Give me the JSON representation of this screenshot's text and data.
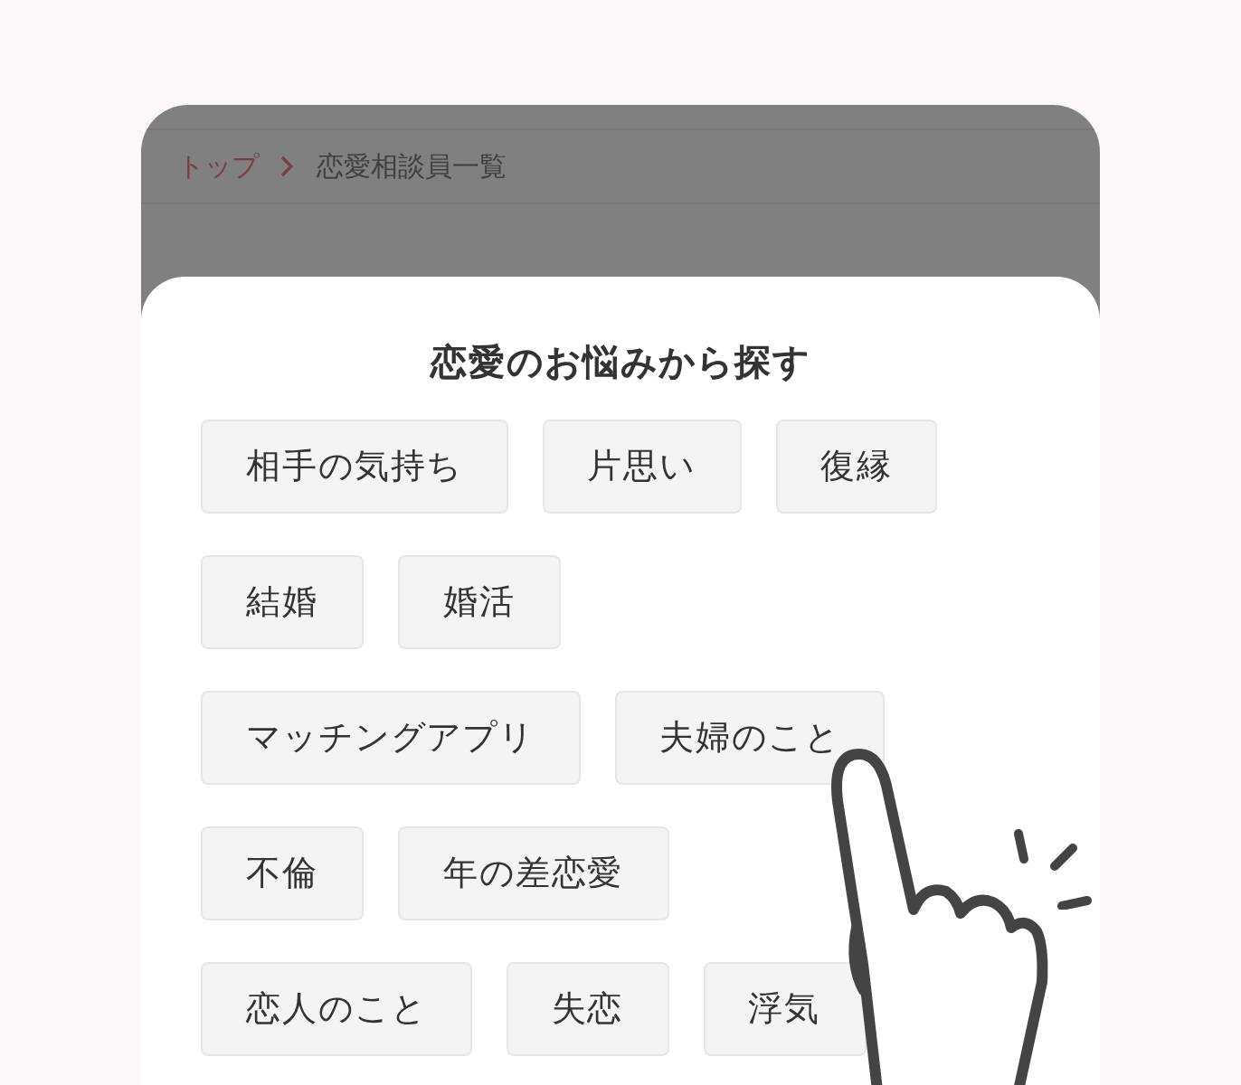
{
  "breadcrumb": [
    {
      "label": "トップ",
      "kind": "link"
    },
    {
      "label": "恋愛相談員一覧",
      "kind": "current"
    }
  ],
  "sheet": {
    "title": "恋愛のお悩みから探す",
    "tags": [
      [
        "相手の気持ち",
        "片思い",
        "復縁"
      ],
      [
        "結婚",
        "婚活"
      ],
      [
        "マッチングアプリ",
        "夫婦のこと"
      ],
      [
        "不倫",
        "年の差恋愛"
      ],
      [
        "恋人のこと",
        "失恋",
        "浮気"
      ]
    ]
  }
}
